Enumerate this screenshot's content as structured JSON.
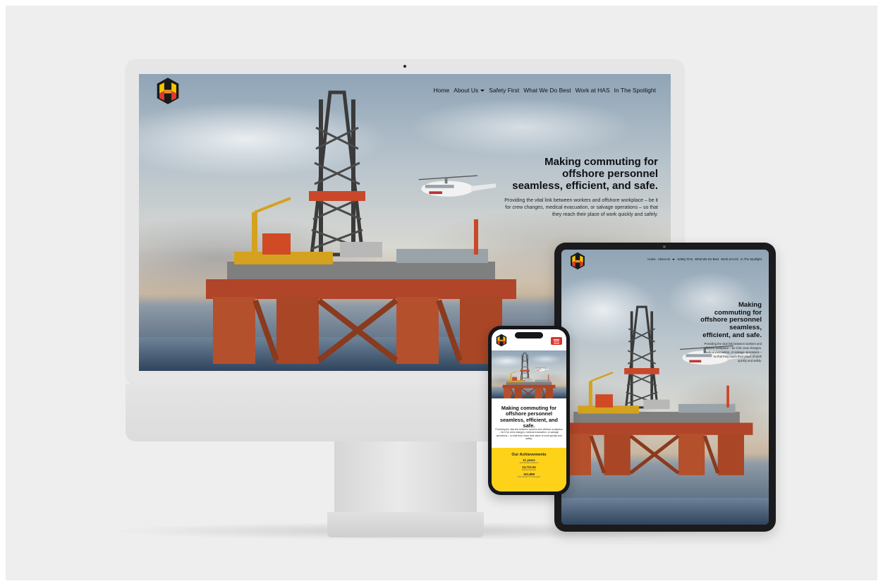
{
  "site": {
    "logo_label": "HAS logo",
    "nav": {
      "home": "Home",
      "about": "About Us",
      "safety": "Safety First",
      "what_we_do": "What We Do Best",
      "work": "Work at HAS",
      "spotlight": "In The Spotlight"
    },
    "hero": {
      "title_line1": "Making commuting for",
      "title_line2": "offshore personnel",
      "title_line3": "seamless, efficient, and safe.",
      "subtitle_line1": "Providing the vital link between workers and offshore workplace – be it",
      "subtitle_line2": "for crew changes, medical evacuation, or salvage operations – so that",
      "subtitle_line3": "they reach their place of work quickly and safely."
    },
    "tablet_hero": {
      "line1": "Making",
      "line2": "commuting for",
      "line3": "offshore personnel",
      "line4": "seamless,",
      "line5": "efficient, and safe.",
      "sub1": "Providing the vital link between workers and",
      "sub2": "offshore workplace – be it for crew changes,",
      "sub3": "medical evacuation, or salvage operations –",
      "sub4": "so that they reach their place of work",
      "sub5": "quickly and safely."
    },
    "mobile": {
      "title_line1": "Making commuting for",
      "title_line2": "offshore personnel",
      "title_line3": "seamless, efficient, and safe.",
      "subtitle": "Providing the vital link between workers and offshore workplace – be it for crew changes, medical evacuation, or salvage operations – so that they reach their place of work quickly and safely.",
      "achievements_title": "Our Achievements",
      "stats": [
        {
          "value": "11 years",
          "label": "Operational Excellence"
        },
        {
          "value": "13,712.04",
          "label": "Total Flying Hours"
        },
        {
          "value": "151,858",
          "label": "Total Number of Passengers"
        }
      ]
    }
  },
  "colors": {
    "accent_red": "#d9352f",
    "accent_yellow": "#ffd21a",
    "logo_red": "#e13a2b",
    "logo_yellow": "#f6c400",
    "logo_dark": "#1a1a1a"
  },
  "icons": {
    "menu": "hamburger-icon",
    "dropdown": "chevron-down-icon"
  }
}
